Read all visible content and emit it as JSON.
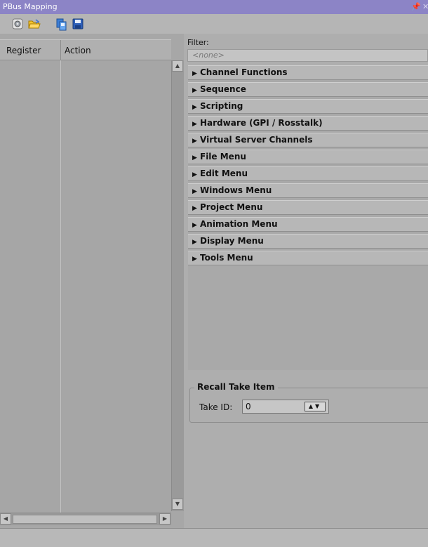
{
  "window": {
    "title": "PBus Mapping",
    "pin_glyph": "⭳",
    "close_glyph": "✕"
  },
  "toolbar": {
    "buttons": [
      {
        "icon": "gear-icon"
      },
      {
        "icon": "folder-open-icon"
      },
      {
        "icon": "copy-icon"
      },
      {
        "icon": "save-icon"
      }
    ]
  },
  "left_table": {
    "columns": [
      "Register",
      "Action"
    ],
    "rows": []
  },
  "filter": {
    "label": "Filter:",
    "placeholder": "<none>"
  },
  "categories": [
    "Channel Functions",
    "Sequence",
    "Scripting",
    "Hardware (GPI / Rosstalk)",
    "Virtual Server Channels",
    "File Menu",
    "Edit Menu",
    "Windows Menu",
    "Project Menu",
    "Animation Menu",
    "Display Menu",
    "Tools Menu"
  ],
  "recall": {
    "title": "Recall Take Item",
    "take_id_label": "Take ID:",
    "take_id_value": "0"
  },
  "colors": {
    "titlebar": "#8c84c6",
    "background": "#ababab"
  }
}
